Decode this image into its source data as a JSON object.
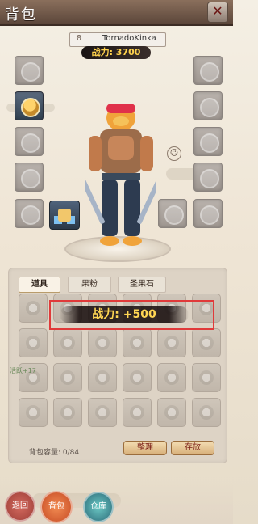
{
  "window": {
    "title": "背包",
    "close_label": "✕"
  },
  "character": {
    "level": "8",
    "name": "TornadoKinka",
    "power_label": "战力: 3700"
  },
  "equipment": {
    "left_slots": [
      {
        "id": "slot-left-1",
        "icon": "necklace-icon"
      },
      {
        "id": "slot-left-2",
        "icon": "armor-icon"
      },
      {
        "id": "slot-left-3",
        "icon": "ring-icon"
      },
      {
        "id": "slot-left-4",
        "icon": "boots-icon"
      },
      {
        "id": "slot-left-5",
        "icon": "bracer-icon"
      }
    ],
    "right_slots": [
      {
        "id": "slot-right-1",
        "icon": "spiral-icon"
      },
      {
        "id": "slot-right-2",
        "icon": "shield-icon"
      },
      {
        "id": "slot-right-3",
        "icon": "orb-icon"
      },
      {
        "id": "slot-right-4",
        "icon": "rune-icon"
      },
      {
        "id": "slot-right-5",
        "icon": "gourd-icon"
      }
    ],
    "extra_slot": {
      "id": "slot-mask",
      "icon": "mask-icon"
    },
    "pet_slot": {
      "id": "slot-pet",
      "icon": "pet-icon"
    }
  },
  "bag": {
    "tabs": [
      {
        "label": "道具",
        "active": true
      },
      {
        "label": "果粉",
        "active": false
      },
      {
        "label": "圣果石",
        "active": false
      }
    ],
    "grid": {
      "rows": 5,
      "cols": 6
    },
    "power_popup": "战力: +500",
    "side_log": "活跃+17",
    "capacity_label": "背包容量: 0/84",
    "sort_label": "整理",
    "store_label": "存放"
  },
  "nav": {
    "back_label": "返回",
    "bag_label": "背包",
    "warehouse_label": "仓库"
  },
  "colors": {
    "accent": "#e03a3a",
    "gold": "#ffd24d"
  }
}
